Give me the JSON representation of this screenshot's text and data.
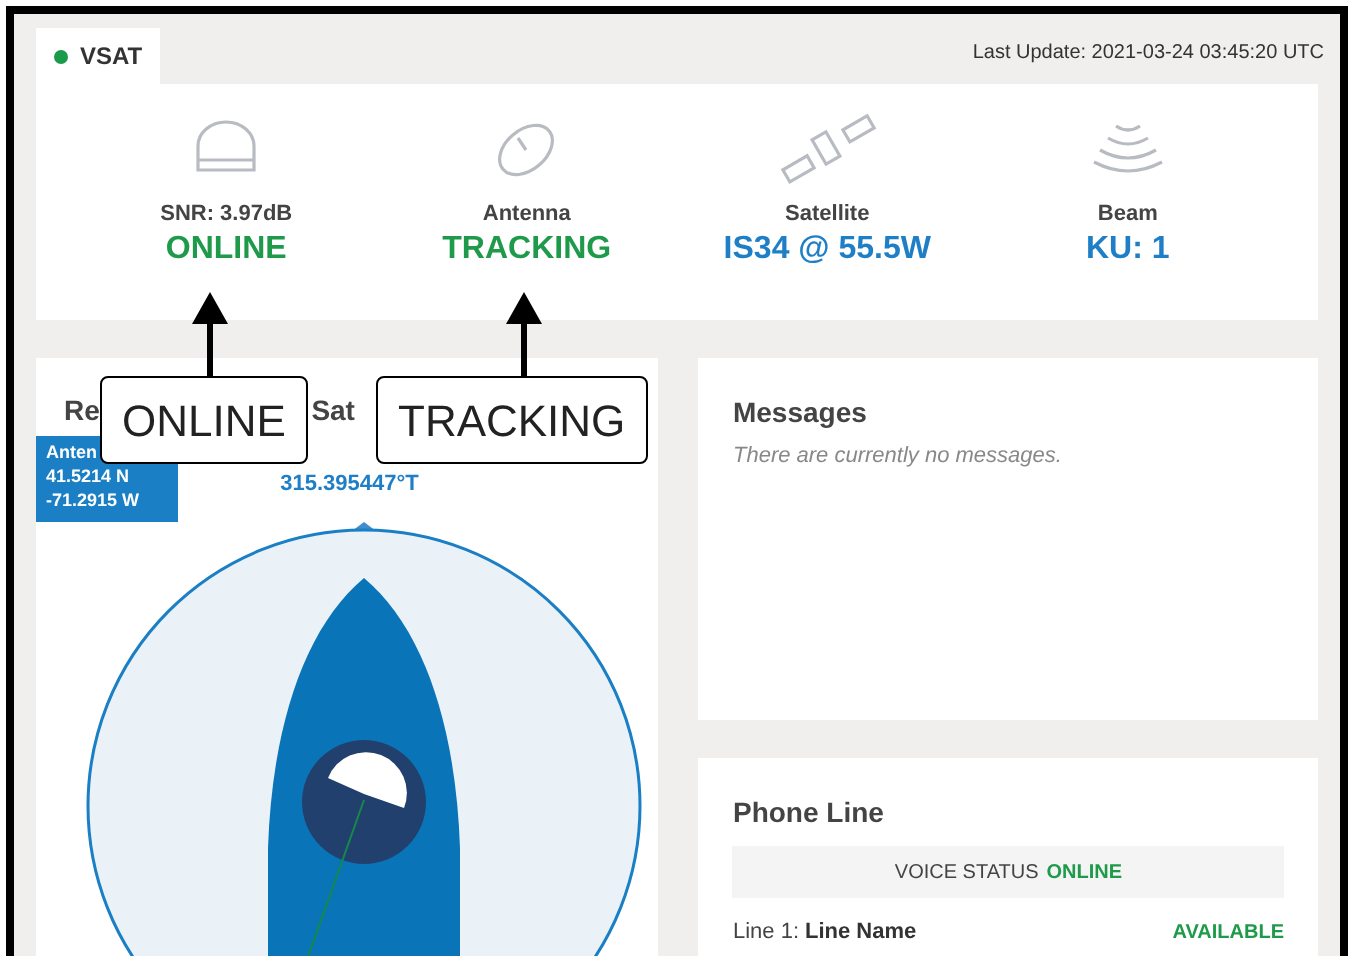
{
  "tabs": [
    {
      "label": "VSAT",
      "color": "#1a9a4a",
      "selected": true
    }
  ],
  "last_update": "Last Update: 2021-03-24 03:45:20 UTC",
  "status_items": [
    {
      "kind": "modem",
      "label": "SNR: 3.97dB",
      "value": "ONLINE",
      "color": "#1f9a4a"
    },
    {
      "kind": "antenna",
      "label": "Antenna",
      "value": "TRACKING",
      "color": "#1f9a4a"
    },
    {
      "kind": "satellite",
      "label": "Satellite",
      "value": "IS34 @ 55.5W",
      "color": "#1f7fc6"
    },
    {
      "kind": "beam",
      "label": "Beam",
      "value": "KU: 1",
      "color": "#1f7fc6"
    }
  ],
  "position_card": {
    "title_start": "Re",
    "title_end": "Sat",
    "antenna_label": "Anten",
    "latitude": "41.5214 N",
    "longitude": "-71.2915 W",
    "heading": "315.395447°T"
  },
  "messages": {
    "title": "Messages",
    "empty_text": "There are currently no messages."
  },
  "phone": {
    "title": "Phone Line",
    "voice_status_label": "VOICE STATUS",
    "voice_status": "ONLINE",
    "lines": [
      {
        "label": "Line 1:",
        "name": "Line Name",
        "status": "AVAILABLE"
      }
    ]
  },
  "callouts": [
    {
      "text": "ONLINE"
    },
    {
      "text": "TRACKING"
    }
  ]
}
